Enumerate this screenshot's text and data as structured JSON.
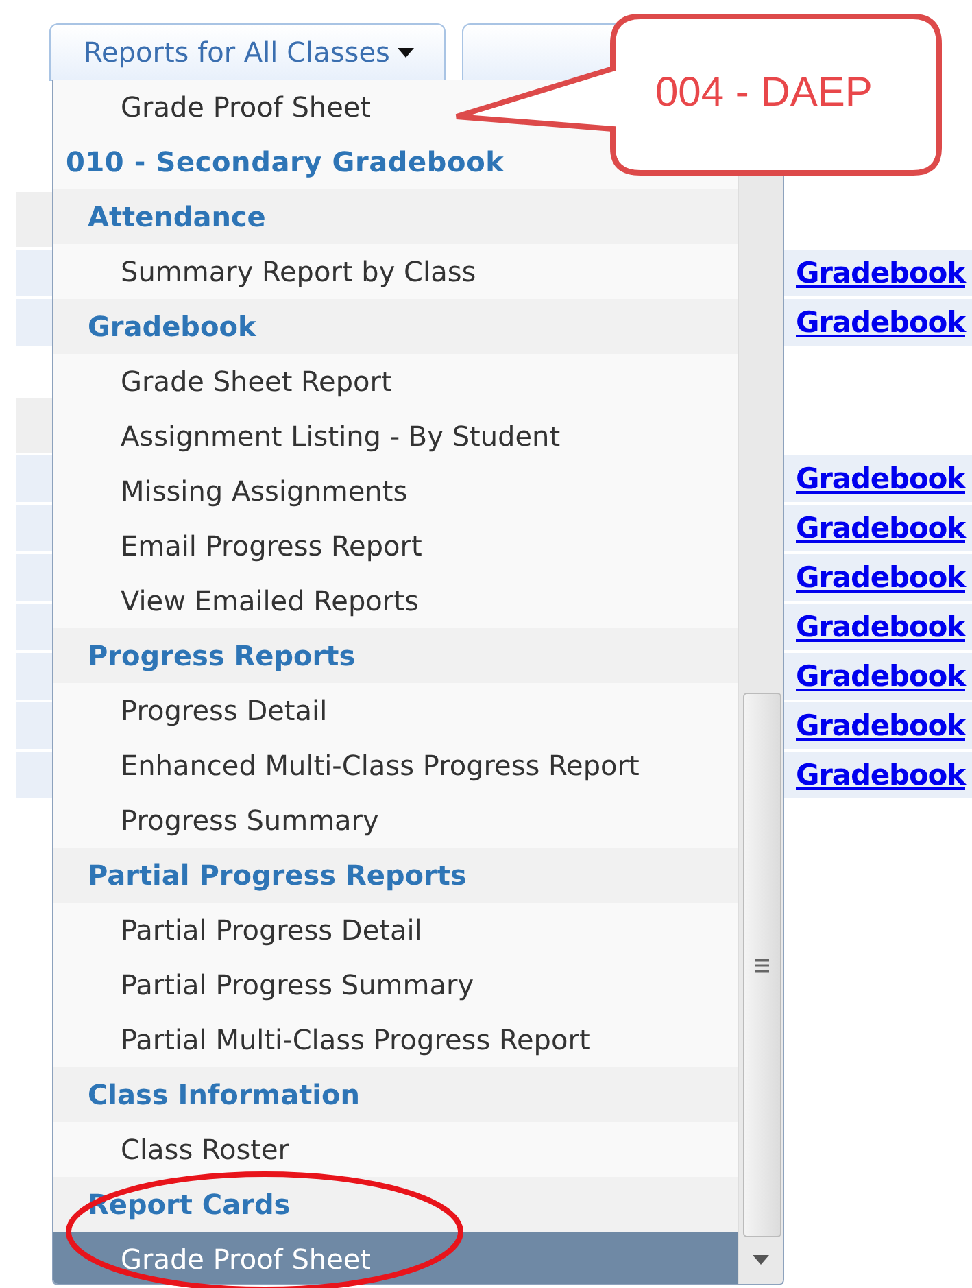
{
  "toolbar": {
    "buttons": [
      {
        "kind": "dropdown",
        "label": "Reports for All Classes"
      },
      {
        "kind": "blank"
      }
    ]
  },
  "background_table": {
    "sections": [
      {
        "links": [
          "Gradebook",
          "Gradebook"
        ]
      },
      {
        "links": [
          "Gradebook",
          "Gradebook",
          "Gradebook",
          "Gradebook",
          "Gradebook",
          "Gradebook",
          "Gradebook"
        ]
      }
    ]
  },
  "menu": {
    "items": [
      {
        "kind": "item",
        "label": "Grade Proof Sheet",
        "selected": false
      },
      {
        "kind": "group",
        "label": "010 - Secondary Gradebook",
        "selected": false
      },
      {
        "kind": "category",
        "label": "Attendance",
        "selected": false
      },
      {
        "kind": "item",
        "label": "Summary Report by Class",
        "selected": false
      },
      {
        "kind": "category",
        "label": "Gradebook",
        "selected": false
      },
      {
        "kind": "item",
        "label": "Grade Sheet Report",
        "selected": false
      },
      {
        "kind": "item",
        "label": "Assignment Listing - By Student",
        "selected": false
      },
      {
        "kind": "item",
        "label": "Missing Assignments",
        "selected": false
      },
      {
        "kind": "item",
        "label": "Email Progress Report",
        "selected": false
      },
      {
        "kind": "item",
        "label": "View Emailed Reports",
        "selected": false
      },
      {
        "kind": "category",
        "label": "Progress Reports",
        "selected": false
      },
      {
        "kind": "item",
        "label": "Progress Detail",
        "selected": false
      },
      {
        "kind": "item",
        "label": "Enhanced Multi-Class Progress Report",
        "selected": false
      },
      {
        "kind": "item",
        "label": "Progress Summary",
        "selected": false
      },
      {
        "kind": "category",
        "label": "Partial Progress Reports",
        "selected": false
      },
      {
        "kind": "item",
        "label": "Partial Progress Detail",
        "selected": false
      },
      {
        "kind": "item",
        "label": "Partial Progress Summary",
        "selected": false
      },
      {
        "kind": "item",
        "label": "Partial Multi-Class Progress Report",
        "selected": false
      },
      {
        "kind": "category",
        "label": "Class Information",
        "selected": false
      },
      {
        "kind": "item",
        "label": "Class Roster",
        "selected": false
      },
      {
        "kind": "category",
        "label": "Report Cards",
        "selected": false
      },
      {
        "kind": "item",
        "label": "Grade Proof Sheet",
        "selected": true
      }
    ]
  },
  "callout": {
    "text": "004 - DAEP"
  }
}
